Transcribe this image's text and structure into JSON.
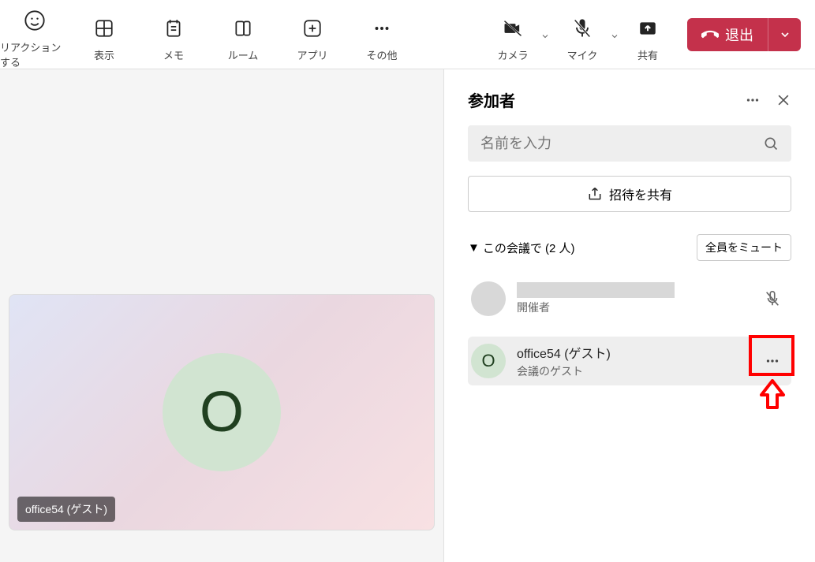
{
  "toolbar": {
    "reaction": "リアクションする",
    "view": "表示",
    "notes": "メモ",
    "room": "ルーム",
    "apps": "アプリ",
    "more": "その他",
    "camera": "カメラ",
    "mic": "マイク",
    "share": "共有",
    "leave": "退出"
  },
  "stage": {
    "avatar_initial": "O",
    "tile_label": "office54 (ゲスト)"
  },
  "panel": {
    "title": "参加者",
    "search_placeholder": "名前を入力",
    "share_invite": "招待を共有",
    "section_label": "この会議で (2 人)",
    "mute_all": "全員をミュート",
    "participants": [
      {
        "name": "",
        "role": "開催者",
        "initial": ""
      },
      {
        "name": "office54 (ゲスト)",
        "role": "会議のゲスト",
        "initial": "O"
      }
    ]
  }
}
